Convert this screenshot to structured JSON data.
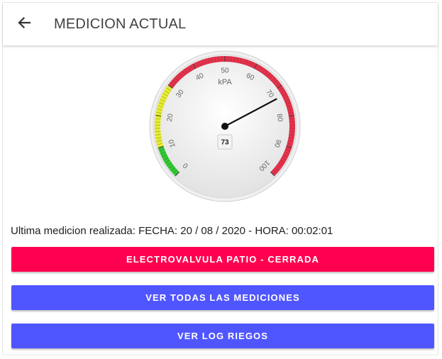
{
  "toolbar": {
    "title": "MEDICION ACTUAL",
    "back_icon": "arrow-left-icon"
  },
  "gauge": {
    "unit": "kPA",
    "value": 73,
    "min": 0,
    "max": 100,
    "ticks": [
      "0",
      "10",
      "20",
      "30",
      "40",
      "50",
      "60",
      "70",
      "80",
      "90",
      "100"
    ],
    "zones": [
      {
        "from": 0,
        "to": 10,
        "color": "#2ecc2e"
      },
      {
        "from": 10,
        "to": 30,
        "color": "#e8ee2a"
      },
      {
        "from": 30,
        "to": 100,
        "color": "#e8304a"
      }
    ]
  },
  "last_measure": {
    "text": "Ultima medicion realizada: FECHA: 20 / 08 / 2020 - HORA: 00:02:01"
  },
  "buttons": {
    "valve": {
      "label": "ELECTROVALVULA PATIO - CERRADA",
      "color": "#ff0050"
    },
    "all_measures": {
      "label": "VER TODAS LAS MEDICIONES",
      "color": "#5056ff"
    },
    "log": {
      "label": "VER LOG RIEGOS",
      "color": "#5056ff"
    }
  }
}
